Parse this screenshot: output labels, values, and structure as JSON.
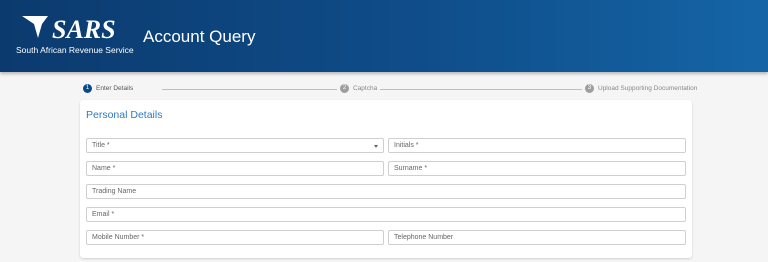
{
  "header": {
    "logo_text": "SARS",
    "org_name": "South African Revenue Service",
    "page_title": "Account Query"
  },
  "stepper": {
    "steps": [
      {
        "number": "1",
        "label": "Enter Details",
        "active": true
      },
      {
        "number": "2",
        "label": "Captcha",
        "active": false
      },
      {
        "number": "3",
        "label": "Upload Supporting Documentation",
        "active": false
      }
    ]
  },
  "form": {
    "section_title": "Personal Details",
    "fields": {
      "title": "Title *",
      "initials": "Initials *",
      "name": "Name *",
      "surname": "Surname *",
      "trading_name": "Trading Name",
      "email": "Email *",
      "mobile": "Mobile Number *",
      "telephone": "Telephone Number"
    }
  },
  "colors": {
    "header_dark": "#0b3a6e",
    "header_light": "#1565a6",
    "step_active": "#0b4a86",
    "section_title": "#2d7bbf"
  },
  "icons": {
    "logo": "sars-logo",
    "dropdown": "chevron-down-icon"
  }
}
